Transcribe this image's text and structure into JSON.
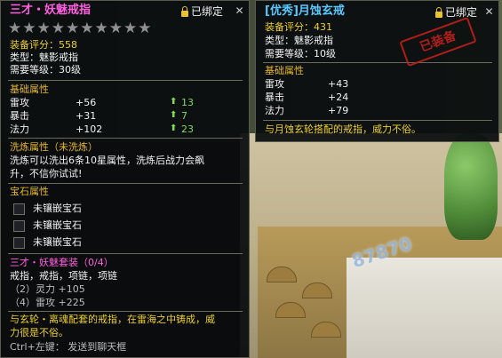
{
  "colors": {
    "title_pink": "#ff5fe0",
    "title_cyan": "#58c8ff",
    "label_gold": "#e6b82f",
    "stat_green": "#7fd95c",
    "text_yellow": "#eccf2c",
    "stamp_red": "#c0201a"
  },
  "left_tooltip": {
    "title": "三才・妖魅戒指",
    "bind_status": "已绑定",
    "close_icon": "close-icon",
    "stars_filled": 0,
    "stars_total": 10,
    "rating": "装备评分：558",
    "type": "类型：魅影戒指",
    "level": "需要等级：30级",
    "base_header": "基础属性",
    "base_stats": [
      {
        "name": "雷攻",
        "value": "+56",
        "bonus": "13"
      },
      {
        "name": "暴击",
        "value": "+31",
        "bonus": "7"
      },
      {
        "name": "法力",
        "value": "+102",
        "bonus": "23"
      }
    ],
    "refine_header": "洗炼属性（未洗炼）",
    "refine_text_1": "洗炼可以洗出6条10星属性，洗炼后战力会飙",
    "refine_text_2": "升，不信你试试!",
    "gem_header": "宝石属性",
    "gems": [
      "未镶嵌宝石",
      "未镶嵌宝石",
      "未镶嵌宝石"
    ],
    "set_header": "三才・妖魅套装（0/4）",
    "set_pieces": "戒指，戒指，项链，项链",
    "set_bonus_1": "（2）灵力 +105",
    "set_bonus_2": "（4）雷攻 +225",
    "desc_1": "与玄轮・离魂配套的戒指，在雷海之中铸成，威",
    "desc_2": "力很是不俗。",
    "ctrl_hint": "Ctrl+左键：  发送到聊天框"
  },
  "right_tooltip": {
    "title": "[优秀]月蚀玄戒",
    "bind_status": "已绑定",
    "close_icon": "close-icon",
    "rating": "装备评分：431",
    "type": "类型：魅影戒指",
    "level": "需要等级：10级",
    "stamp": "已装备",
    "base_header": "基础属性",
    "base_stats": [
      {
        "name": "雷攻",
        "value": "+43"
      },
      {
        "name": "暴击",
        "value": "+24"
      },
      {
        "name": "法力",
        "value": "+79"
      }
    ],
    "desc": "与月蚀玄轮搭配的戒指，威力不俗。"
  },
  "scene": {
    "watermark": "87870"
  }
}
